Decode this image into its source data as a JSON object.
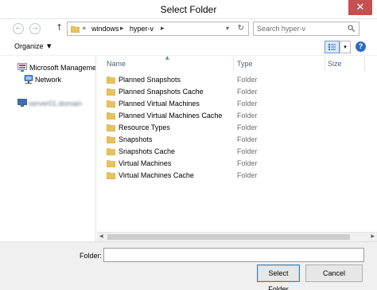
{
  "window": {
    "title": "Select Folder",
    "close_glyph": "✕"
  },
  "nav": {
    "back_glyph": "←",
    "forward_glyph": "→",
    "up_glyph": "↑",
    "address": {
      "overflow": "«",
      "crumbs": [
        "windows",
        "hyper-v"
      ],
      "separator": "▸",
      "dropdown_glyph": "▾",
      "refresh_glyph": "↻"
    },
    "search": {
      "placeholder": "Search hyper-v",
      "value": ""
    }
  },
  "toolbar": {
    "organize_label": "Organize",
    "organize_caret": "▼",
    "view_dropdown_glyph": "▾",
    "help_glyph": "?"
  },
  "sidebar": {
    "items": [
      {
        "label": "Microsoft Managemen",
        "icon": "management-console-icon"
      },
      {
        "label": "Network",
        "icon": "network-icon"
      },
      {
        "label": "server01.domain",
        "icon": "computer-icon"
      }
    ]
  },
  "filelist": {
    "columns": [
      "Name",
      "Type",
      "Size"
    ],
    "sort_glyph": "▲",
    "rows": [
      {
        "name": "Planned Snapshots",
        "type": "Folder"
      },
      {
        "name": "Planned Snapshots Cache",
        "type": "Folder"
      },
      {
        "name": "Planned Virtual Machines",
        "type": "Folder"
      },
      {
        "name": "Planned Virtual Machines Cache",
        "type": "Folder"
      },
      {
        "name": "Resource Types",
        "type": "Folder"
      },
      {
        "name": "Snapshots",
        "type": "Folder"
      },
      {
        "name": "Snapshots Cache",
        "type": "Folder"
      },
      {
        "name": "Virtual Machines",
        "type": "Folder"
      },
      {
        "name": "Virtual Machines Cache",
        "type": "Folder"
      }
    ]
  },
  "scrollbar": {
    "left_glyph": "◀",
    "right_glyph": "▶"
  },
  "footer": {
    "folder_label": "Folder:",
    "folder_value": "",
    "select_label": "Select Folder",
    "cancel_label": "Cancel"
  },
  "colors": {
    "close_button": "#c74f4f",
    "folder_icon": "#e8c25c",
    "selection_blue": "#2b6cc4",
    "header_text": "#4c607a"
  }
}
